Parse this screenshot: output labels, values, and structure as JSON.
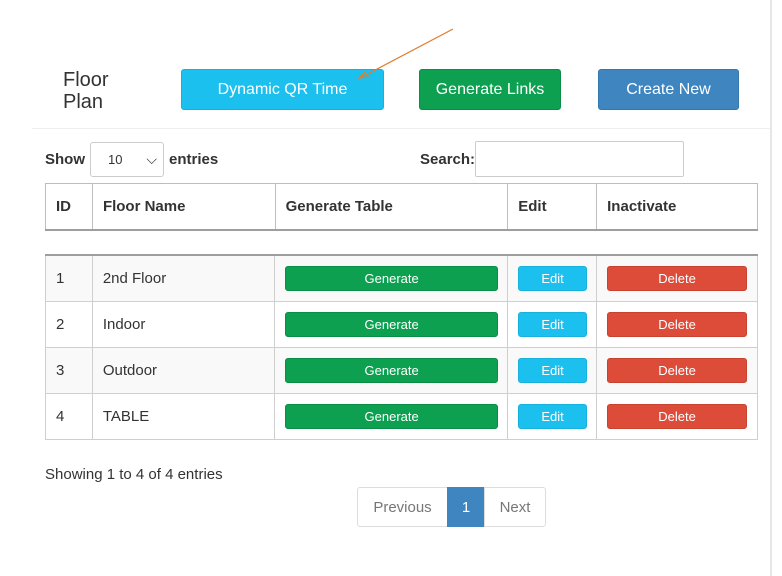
{
  "header": {
    "title": "Floor Plan",
    "buttons": {
      "qr": "Dynamic QR Time",
      "links": "Generate Links",
      "create": "Create New"
    }
  },
  "controls": {
    "show_label": "Show",
    "entries_label": "entries",
    "page_length": "10",
    "search_label": "Search:",
    "search_value": ""
  },
  "table": {
    "columns": [
      "ID",
      "Floor Name",
      "Generate Table",
      "Edit",
      "Inactivate"
    ],
    "rows": [
      {
        "id": "1",
        "name": "2nd Floor",
        "generate": "Generate",
        "edit": "Edit",
        "delete": "Delete"
      },
      {
        "id": "2",
        "name": "Indoor",
        "generate": "Generate",
        "edit": "Edit",
        "delete": "Delete"
      },
      {
        "id": "3",
        "name": "Outdoor",
        "generate": "Generate",
        "edit": "Edit",
        "delete": "Delete"
      },
      {
        "id": "4",
        "name": "TABLE",
        "generate": "Generate",
        "edit": "Edit",
        "delete": "Delete"
      }
    ]
  },
  "footer": {
    "info": "Showing 1 to 4 of 4 entries",
    "pagination": {
      "previous": "Previous",
      "current": "1",
      "next": "Next"
    }
  },
  "colors": {
    "info_button": "#1cc0ef",
    "success_button": "#0da050",
    "primary_button": "#3f86c0",
    "danger_button": "#dd4b39",
    "annotation_arrow": "#e07b2e"
  }
}
